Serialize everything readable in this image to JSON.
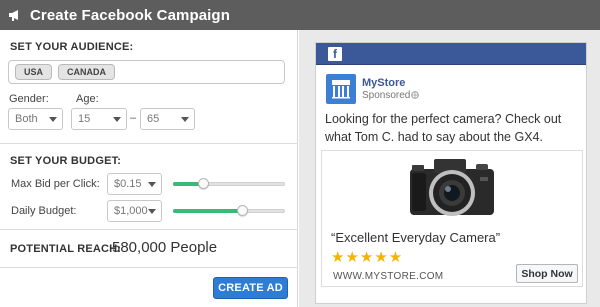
{
  "window": {
    "title": "Create Facebook Campaign",
    "icon": "megaphone-icon"
  },
  "audience": {
    "section_label": "SET YOUR AUDIENCE:",
    "countries": [
      "USA",
      "CANADA"
    ],
    "gender_label": "Gender:",
    "gender_value": "Both",
    "age_label": "Age:",
    "age_min": "15",
    "age_separator": "–",
    "age_max": "65"
  },
  "budget": {
    "section_label": "SET YOUR BUDGET:",
    "max_bid_label": "Max Bid per Click:",
    "max_bid_value": "$0.15",
    "max_bid_slider_fraction": 0.27,
    "daily_budget_label": "Daily Budget:",
    "daily_budget_value": "$1,000",
    "daily_budget_slider_fraction": 0.62
  },
  "reach": {
    "label": "POTENTIAL REACH:",
    "value": "580,000 People"
  },
  "actions": {
    "create_label": "CREATE AD"
  },
  "ad_preview": {
    "platform_badge": "f",
    "store_name": "MyStore",
    "sponsored": "Sponsored",
    "body": "Looking for the perfect camera? Check out what Tom C. had to say about the GX4.",
    "quote": "“Excellent Everyday Camera”",
    "stars": "★★★★★",
    "rating": 5,
    "url": "WWW.MYSTORE.COM",
    "cta": "Shop Now"
  },
  "colors": {
    "titlebar": "#5d5d5d",
    "facebook_blue": "#3b5998",
    "slider_fill": "#3cb878",
    "primary_button": "#2d7cd6",
    "star": "#f4b400"
  }
}
